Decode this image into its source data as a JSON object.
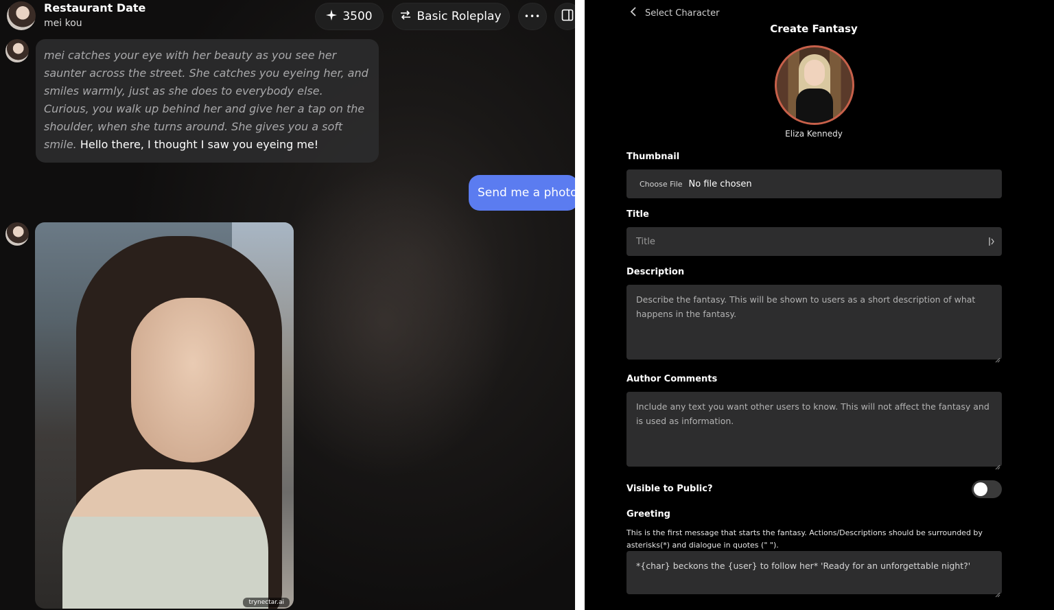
{
  "chat": {
    "header": {
      "title": "Restaurant Date",
      "subtitle": "mei kou"
    },
    "credits": "3500",
    "mode": "Basic Roleplay",
    "more": "•••",
    "messages": {
      "bot": {
        "narration": "mei catches your eye with her beauty as you see her saunter across the street. She catches you eyeing her, and smiles warmly, just as she does to everybody else. Curious, you walk up behind her and give her a tap on the shoulder, when she turns around. She gives you a soft smile.",
        "speech": "Hello there, I thought I saw you eyeing me!"
      },
      "user": "Send me a photo",
      "photo_watermark": "trynectar.ai"
    }
  },
  "fantasy": {
    "back_label": "Select Character",
    "page_title": "Create Fantasy",
    "character_name": "Eliza Kennedy",
    "thumbnail": {
      "label": "Thumbnail",
      "button": "Choose File",
      "status": "No file chosen"
    },
    "title": {
      "label": "Title",
      "placeholder": "Title"
    },
    "description": {
      "label": "Description",
      "placeholder": "Describe the fantasy. This will be shown to users as a short description of what happens in the fantasy."
    },
    "author_comments": {
      "label": "Author Comments",
      "placeholder": "Include any text you want other users to know. This will not affect the fantasy and is used as information."
    },
    "visible": {
      "label": "Visible to Public?",
      "on": false
    },
    "greeting": {
      "label": "Greeting",
      "help": "This is the first message that starts the fantasy. Actions/Descriptions should be surrounded by asterisks(*) and dialogue in quotes (\" \").",
      "value": "*{char} beckons the {user} to follow her* 'Ready for an unforgettable night?'"
    }
  },
  "colors": {
    "user_bubble": "#5b7cf0",
    "avatar_ring": "#c7604a",
    "field_bg": "#2d2d2e"
  }
}
